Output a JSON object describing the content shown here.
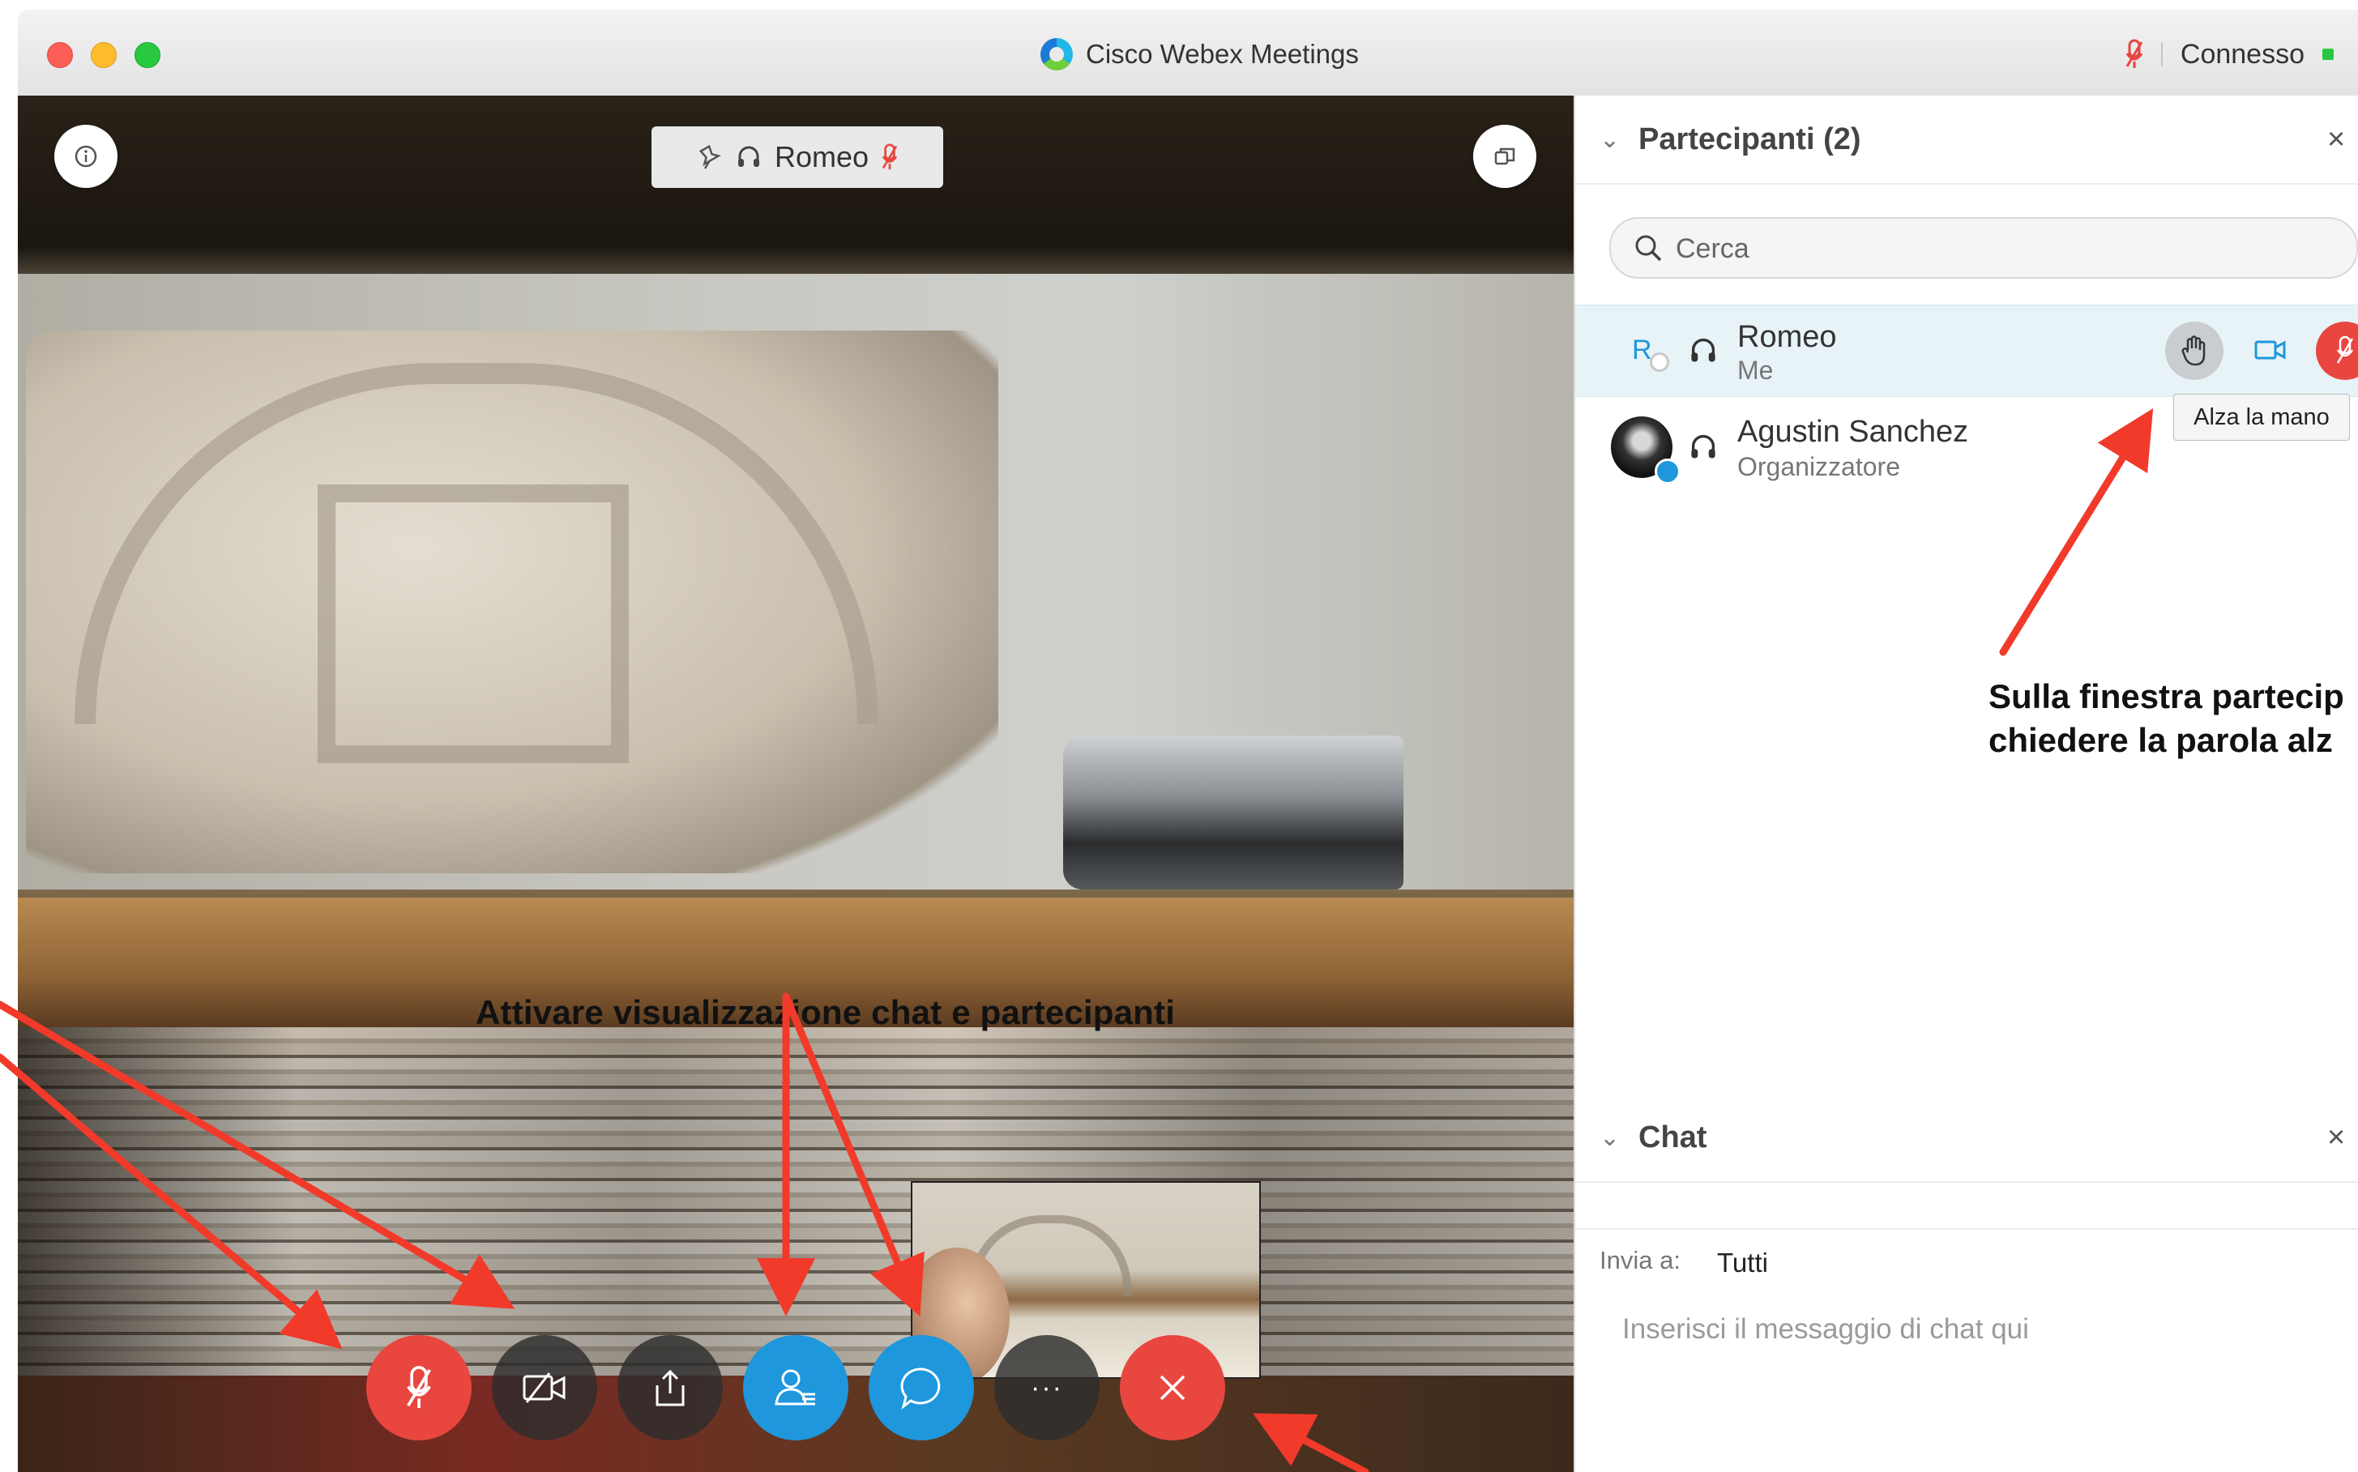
{
  "window": {
    "title": "Cisco Webex Meetings",
    "connection_status": "Connesso",
    "status_color": "#28c840",
    "mute_color": "#e8463f"
  },
  "video": {
    "speaker_name": "Romeo",
    "annotation_controls": "Attivare visualizzazione chat e partecipanti"
  },
  "controls": {
    "mute": "microphone-muted-icon",
    "video": "video-off-icon",
    "share": "share-icon",
    "participants": "participants-icon",
    "chat": "chat-icon",
    "more": "···",
    "leave": "close-icon"
  },
  "participants_panel": {
    "title": "Partecipanti (2)",
    "search_placeholder": "Cerca",
    "items": [
      {
        "initial": "R",
        "name": "Romeo",
        "role": "Me"
      },
      {
        "name": "Agustin Sanchez",
        "role": "Organizzatore"
      }
    ],
    "raise_hand_tooltip": "Alza la mano",
    "annotation_line1": "Sulla finestra partecip",
    "annotation_line2": "chiedere la parola alz"
  },
  "chat_panel": {
    "title": "Chat",
    "send_to_label": "Invia a:",
    "send_to_value": "Tutti",
    "input_placeholder": "Inserisci il messaggio di chat qui"
  },
  "colors": {
    "accent_blue": "#1e97dc",
    "danger_red": "#e8463f",
    "annotation_arrow": "#f23a2a"
  }
}
